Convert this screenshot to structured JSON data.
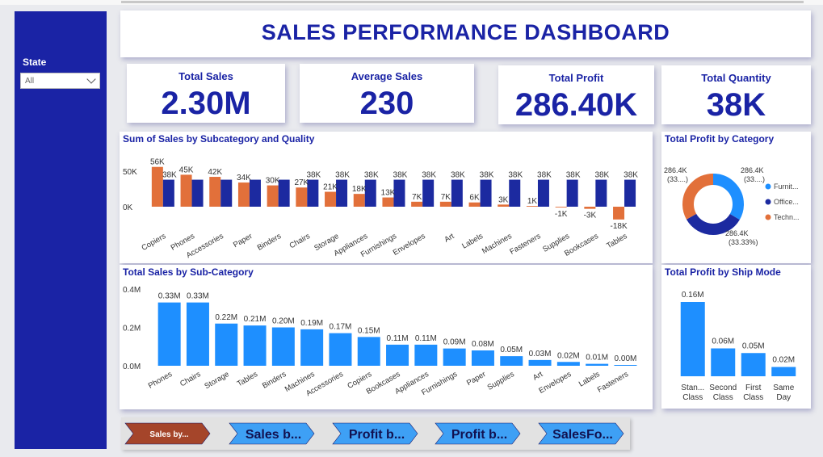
{
  "dashboard": {
    "title": "SALES PERFORMANCE DASHBOARD"
  },
  "filter": {
    "label": "State",
    "value": "All"
  },
  "kpis": [
    {
      "label": "Total Sales",
      "value": "2.30M"
    },
    {
      "label": "Average Sales",
      "value": "230"
    },
    {
      "label": "Total Profit",
      "value": "286.40K"
    },
    {
      "label": "Total Quantity",
      "value": "38K"
    }
  ],
  "nav_buttons": [
    {
      "label": "Sales by..."
    },
    {
      "label": "Sales b..."
    },
    {
      "label": "Profit b..."
    },
    {
      "label": "Profit b..."
    },
    {
      "label": "SalesFo..."
    }
  ],
  "colors": {
    "primary": "#1a23a5",
    "orange": "#e2703a",
    "navy": "#1c2aa0",
    "blue": "#1e8fff",
    "nav_active": "#a5452a",
    "nav_inactive": "#3ea0f5"
  },
  "chart_data": [
    {
      "type": "bar",
      "title": "Sum of Sales by Subcategory and Quality",
      "categories": [
        "Copiers",
        "Phones",
        "Accessories",
        "Paper",
        "Binders",
        "Chairs",
        "Storage",
        "Appliances",
        "Furnishings",
        "Envelopes",
        "Art",
        "Labels",
        "Machines",
        "Fasteners",
        "Supplies",
        "Bookcases",
        "Tables"
      ],
      "series": [
        {
          "values": [
            56000,
            45000,
            42000,
            34000,
            30000,
            27000,
            21000,
            18000,
            13000,
            7000,
            7000,
            6000,
            3000,
            1000,
            -1000,
            -3000,
            -18000
          ],
          "labels": [
            "56K",
            "45K",
            "42K",
            "34K",
            "30K",
            "27K",
            "21K",
            "18K",
            "13K",
            "7K",
            "7K",
            "6K",
            "3K",
            "1K",
            "-1K",
            "-3K",
            "-18K"
          ]
        },
        {
          "values": [
            38000,
            38000,
            38000,
            38000,
            38000,
            38000,
            38000,
            38000,
            38000,
            38000,
            38000,
            38000,
            38000,
            38000,
            38000,
            38000,
            38000
          ],
          "labels": [
            "38K",
            "",
            "",
            "",
            "",
            "38K",
            "38K",
            "38K",
            "38K",
            "38K",
            "38K",
            "38K",
            "38K",
            "38K",
            "38K",
            "38K",
            "38K"
          ]
        }
      ],
      "yticks": [
        {
          "value": 50000,
          "label": "50K"
        },
        {
          "value": 0,
          "label": "0K"
        }
      ],
      "ylim": [
        -25000,
        65000
      ]
    },
    {
      "type": "pie",
      "title": "Total Profit by Category",
      "categories": [
        "Furnit...",
        "Office...",
        "Techn..."
      ],
      "values": [
        286.4,
        286.4,
        286.4
      ],
      "colors": [
        "#1e8fff",
        "#1c2aa0",
        "#e2703a"
      ],
      "slice_labels": [
        "286.4K (33....)",
        "286.4K (33.33%)",
        "286.4K (33....)"
      ]
    },
    {
      "type": "bar",
      "title": "Total Sales by Sub-Category",
      "categories": [
        "Phones",
        "Chairs",
        "Storage",
        "Tables",
        "Binders",
        "Machines",
        "Accessories",
        "Copiers",
        "Bookcases",
        "Appliances",
        "Furnishings",
        "Paper",
        "Supplies",
        "Art",
        "Envelopes",
        "Labels",
        "Fasteners"
      ],
      "values": [
        0.33,
        0.33,
        0.22,
        0.21,
        0.2,
        0.19,
        0.17,
        0.15,
        0.11,
        0.11,
        0.09,
        0.08,
        0.05,
        0.03,
        0.02,
        0.01,
        0.0
      ],
      "labels": [
        "0.33M",
        "0.33M",
        "0.22M",
        "0.21M",
        "0.20M",
        "0.19M",
        "0.17M",
        "0.15M",
        "0.11M",
        "0.11M",
        "0.09M",
        "0.08M",
        "0.05M",
        "0.03M",
        "0.02M",
        "0.01M",
        "0.00M"
      ],
      "yticks": [
        {
          "value": 0.4,
          "label": "0.4M"
        },
        {
          "value": 0.2,
          "label": "0.2M"
        },
        {
          "value": 0,
          "label": "0.0M"
        }
      ],
      "ylim": [
        0,
        0.4
      ]
    },
    {
      "type": "bar",
      "title": "Total Profit by Ship Mode",
      "categories": [
        [
          "Stan...",
          "Class"
        ],
        [
          "Second",
          "Class"
        ],
        [
          "First",
          "Class"
        ],
        [
          "Same",
          "Day"
        ]
      ],
      "values": [
        0.16,
        0.06,
        0.05,
        0.02
      ],
      "labels": [
        "0.16M",
        "0.06M",
        "0.05M",
        "0.02M"
      ],
      "ylim": [
        0,
        0.16
      ]
    }
  ]
}
